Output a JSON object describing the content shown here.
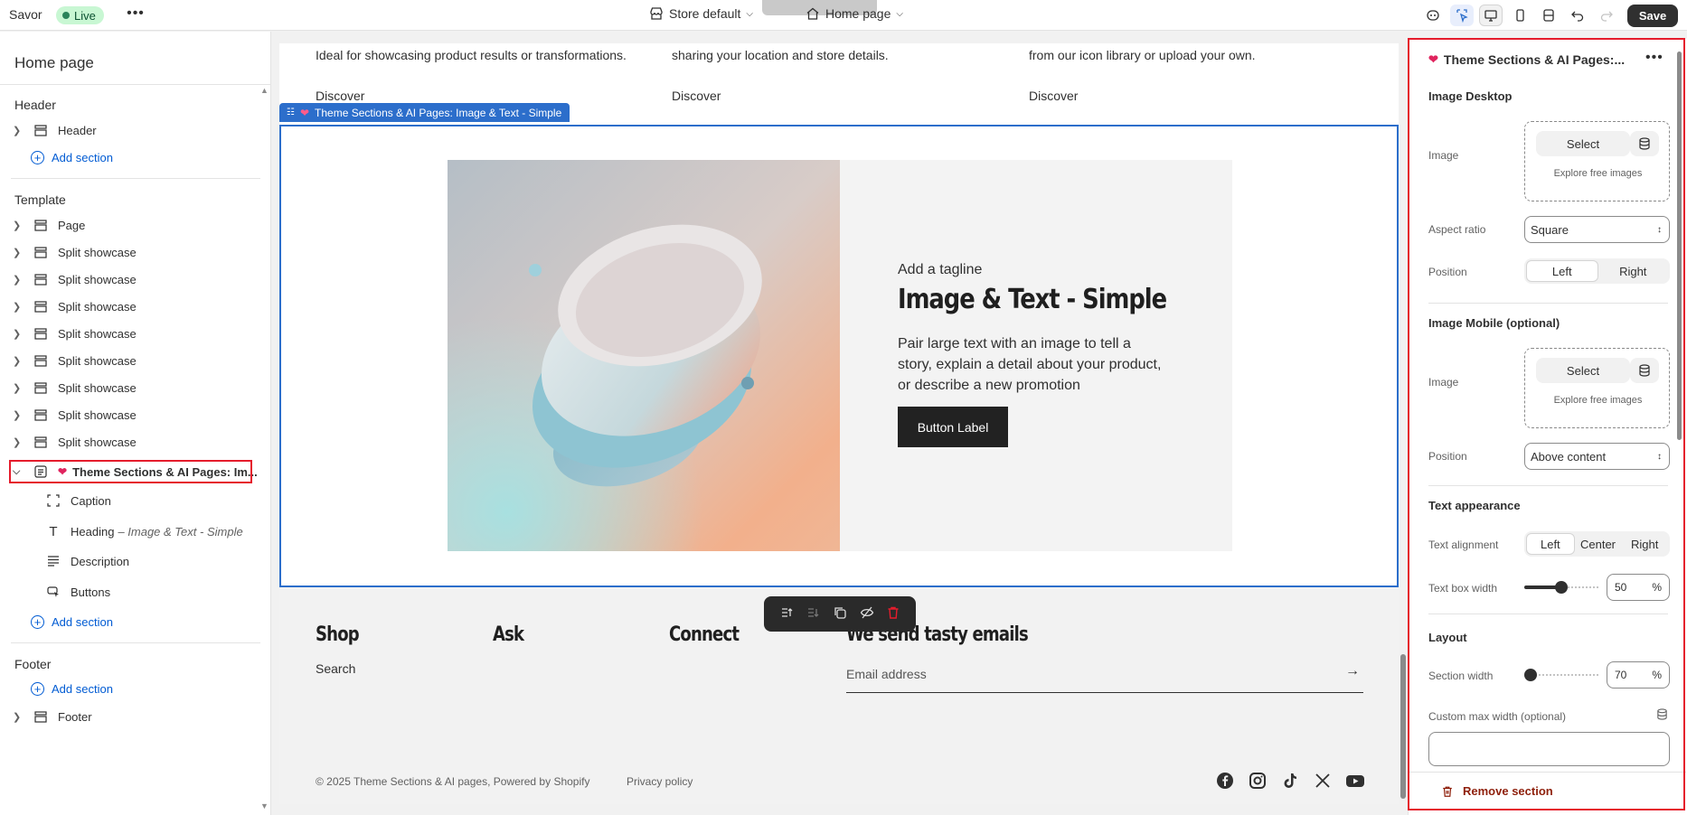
{
  "topbar": {
    "app_name": "Savor",
    "status": "Live",
    "store_selector": "Store default",
    "page_selector": "Home page",
    "save_label": "Save"
  },
  "left": {
    "title": "Home page",
    "header_group": "Header",
    "header_item": "Header",
    "add_section": "Add section",
    "template_group": "Template",
    "template_items": [
      "Page",
      "Split showcase",
      "Split showcase",
      "Split showcase",
      "Split showcase",
      "Split showcase",
      "Split showcase",
      "Split showcase",
      "Split showcase"
    ],
    "selected_item": "Theme Sections & AI Pages: Im...",
    "blocks": {
      "caption": "Caption",
      "heading": "Heading",
      "heading_sub": "– Image & Text - Simple",
      "description": "Description",
      "buttons": "Buttons"
    },
    "footer_group": "Footer",
    "footer_item": "Footer"
  },
  "canvas": {
    "top_texts": [
      "Ideal for showcasing product results or transformations.",
      "sharing your location and store details.",
      "from our icon library or upload your own."
    ],
    "discover": "Discover",
    "section_tag": "Theme Sections & AI Pages: Image & Text - Simple",
    "tagline": "Add a tagline",
    "heading": "Image & Text - Simple",
    "description": "Pair large text with an image to tell a story, explain a detail about your product, or describe a new promotion",
    "button": "Button Label",
    "footer": {
      "shop": "Shop",
      "ask": "Ask",
      "connect": "Connect",
      "newsletter": "We send tasty emails",
      "search": "Search",
      "email_placeholder": "Email address",
      "copyright": "© 2025 Theme Sections & AI pages, Powered by Shopify",
      "privacy": "Privacy policy"
    }
  },
  "settings": {
    "title": "Theme Sections & AI Pages:...",
    "image_desktop": "Image Desktop",
    "image_label": "Image",
    "select": "Select",
    "explore": "Explore free images",
    "aspect_ratio_label": "Aspect ratio",
    "aspect_ratio": "Square",
    "position_label": "Position",
    "position_left": "Left",
    "position_right": "Right",
    "image_mobile": "Image Mobile (optional)",
    "mobile_position": "Above content",
    "text_appearance": "Text appearance",
    "text_alignment_label": "Text alignment",
    "align_left": "Left",
    "align_center": "Center",
    "align_right": "Right",
    "text_box_width_label": "Text box width",
    "text_box_width": "50",
    "text_box_width_fraction": 0.5,
    "percent": "%",
    "layout": "Layout",
    "section_width_label": "Section width",
    "section_width": "70",
    "section_width_fraction": 0.0,
    "custom_max_width": "Custom max width (optional)",
    "remove_section": "Remove section"
  },
  "colors": {
    "accent": "#2c6ecb",
    "highlight": "#e51c2c",
    "live_bg": "#c8f7d3",
    "remove": "#8e1f0b"
  }
}
